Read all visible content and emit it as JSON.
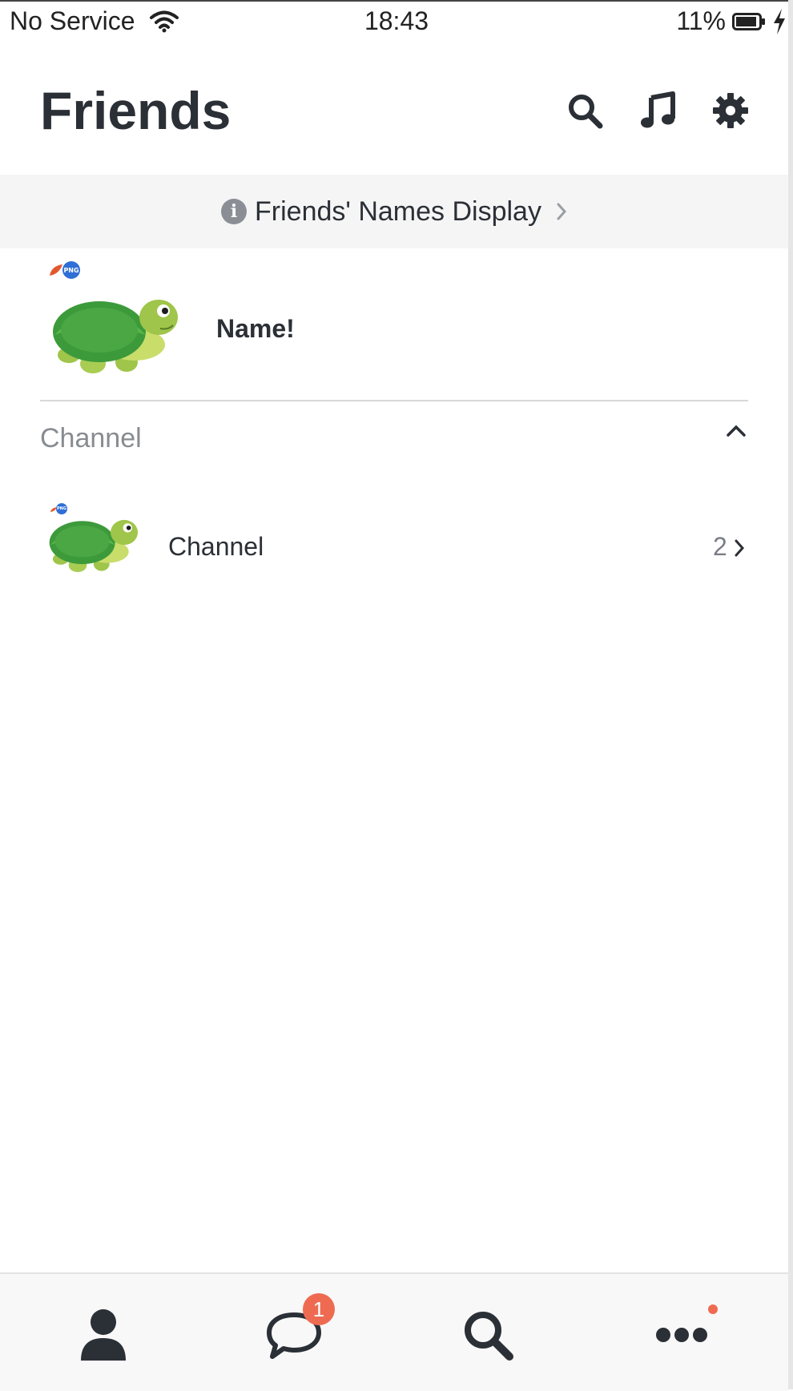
{
  "status_bar": {
    "carrier": "No Service",
    "time": "18:43",
    "battery": "11%"
  },
  "header": {
    "title": "Friends",
    "icons": [
      "search-icon",
      "music-note-icon",
      "gear-icon"
    ]
  },
  "info_banner": {
    "text": "Friends' Names Display"
  },
  "profile": {
    "name": "Name!",
    "badge": "PNG"
  },
  "section": {
    "label": "Channel"
  },
  "channel": {
    "name": "Channel",
    "count": "2",
    "badge": "PNG"
  },
  "tabbar": {
    "tabs": [
      "person-icon",
      "chat-icon",
      "search-icon",
      "more-icon"
    ],
    "chat_badge": "1"
  },
  "colors": {
    "accent_badge": "#ee6b52",
    "png_badge": "#2f6fd6",
    "text_dark": "#2b2f36"
  }
}
